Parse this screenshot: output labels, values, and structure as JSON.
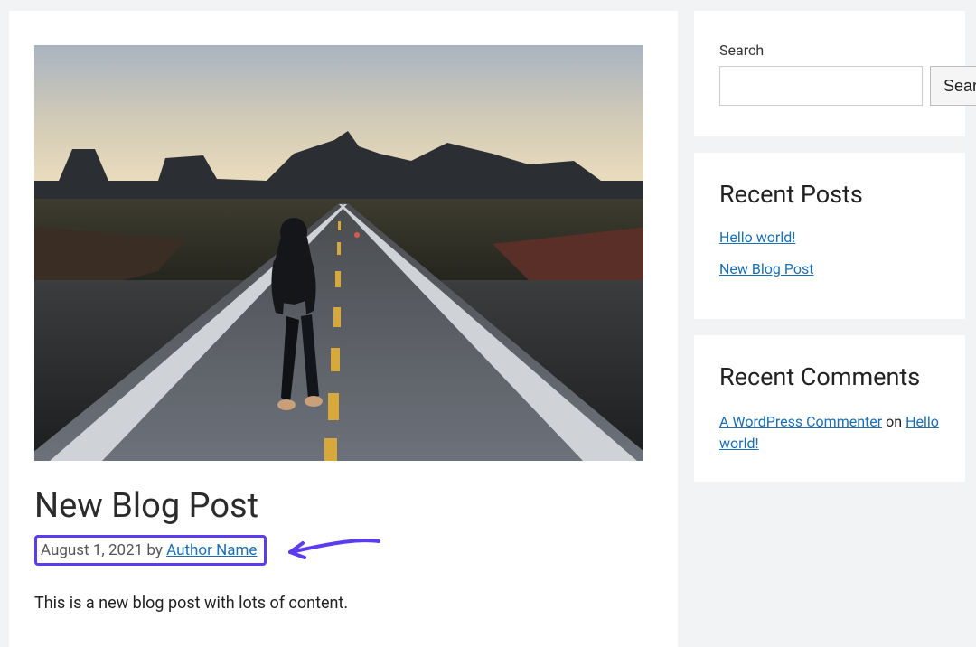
{
  "post": {
    "title": "New Blog Post",
    "date": "August 1, 2021",
    "by_word": "by",
    "author": "Author Name",
    "body": "This is a new blog post with lots of content."
  },
  "sidebar": {
    "search": {
      "label": "Search",
      "button": "Search"
    },
    "recent_posts": {
      "heading": "Recent Posts",
      "items": [
        "Hello world!",
        "New Blog Post"
      ]
    },
    "recent_comments": {
      "heading": "Recent Comments",
      "commenter": "A WordPress Commenter",
      "on_word": "on",
      "post": "Hello world!"
    }
  }
}
